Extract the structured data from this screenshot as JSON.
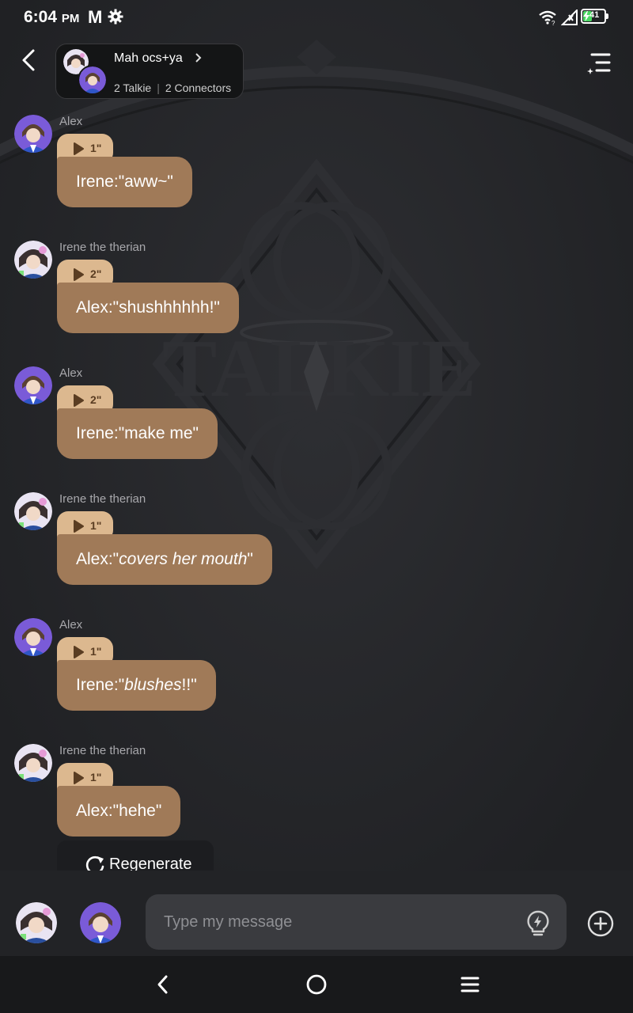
{
  "status_bar": {
    "time": "6:04",
    "meridiem": "PM",
    "mail_icon": "M",
    "battery_level": "41",
    "battery_color": "#4cd964"
  },
  "header": {
    "group_name": "Mah ocs+ya",
    "talkie_count": "2 Talkie",
    "connector_count": "2 Connectors",
    "back_icon": "chevron-left-icon",
    "menu_icon": "sparkle-menu-icon"
  },
  "background": {
    "watermark": "TALKIE",
    "watermark_letter": "I"
  },
  "messages": [
    {
      "sender": "Alex",
      "duration": "1\"",
      "prefix": "Irene:\"",
      "italic": "",
      "text": "aww~\""
    },
    {
      "sender": "Irene the therian",
      "duration": "2\"",
      "prefix": "Alex:\"",
      "italic": "",
      "text": "shushhhhhh!\""
    },
    {
      "sender": "Alex",
      "duration": "2\"",
      "prefix": "Irene:\"",
      "italic": "",
      "text": "make me\""
    },
    {
      "sender": "Irene the therian",
      "duration": "1\"",
      "prefix": "Alex:\"",
      "italic": "covers her mouth",
      "text": "\""
    },
    {
      "sender": "Alex",
      "duration": "1\"",
      "prefix": "Irene:\"",
      "italic": "blushes",
      "text": "!!\""
    },
    {
      "sender": "Irene the therian",
      "duration": "1\"",
      "prefix": "Alex:\"",
      "italic": "",
      "text": "hehe\""
    }
  ],
  "regenerate": {
    "label": "Regenerate"
  },
  "composer": {
    "placeholder": "Type my message",
    "hint_icon": "lightbulb-icon",
    "plus_icon": "plus-circle-icon"
  },
  "colors": {
    "bubble": "#a07a58",
    "voice_pill": "#dcb88f",
    "background": "#222326",
    "input_field": "#3a3b3f"
  },
  "nav_bar": {
    "back_icon": "nav-back-icon",
    "home_icon": "nav-home-icon",
    "recents_icon": "nav-recents-icon"
  }
}
